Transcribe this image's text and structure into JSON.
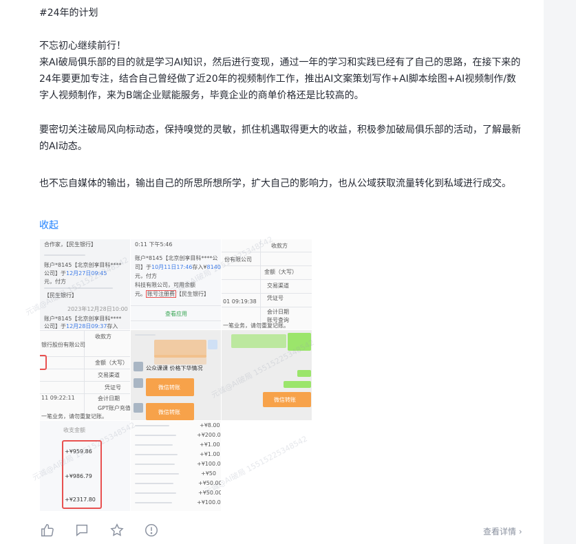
{
  "post": {
    "hashtag": "#24年的计划",
    "paragraph1": "不忘初心继续前行！\n来AI破局俱乐部的目的就是学习AI知识，然后进行变现，通过一年的学习和实践已经有了自己的思路，在接下来的24年要更加专注，结合自己曾经做了近20年的视频制作工作，推出AI文案策划写作+AI脚本绘图+AI视频制作/数字人视频制作，来为B端企业赋能服务，毕竟企业的商单价格还是比较高的。",
    "paragraph2": "要密切关注破局风向标动态，保持嗅觉的灵敏，抓住机遇取得更大的收益，积极参加破局俱乐部的活动，了解最新的AI动态。",
    "paragraph3": "也不忘自媒体的输出，输出自己的所思所想所学，扩大自己的影响力，也从公域获取流量转化到私域进行成交。",
    "collapse_label": "收起"
  },
  "images": {
    "img1": {
      "top_text": "合作家，【民生银行】",
      "acct_line1": "账户*8145【北京创享目科****",
      "acct_line2": "公司】于",
      "date1": "12月27日09:45",
      "acct_line3": "元，付方",
      "bank": "【民生银行】",
      "time_label": "2023年12月28日10:00",
      "acct2_line1": "账户*8145【北京创享目科****",
      "acct2_line2": "公司】于",
      "date2": "12月28日09:37",
      "suffix": "存入"
    },
    "img2": {
      "status": "0:11 下午5:46",
      "account_line": "账户*8145【北京创享目科****公",
      "line2_prefix": "司】于",
      "date": "10月11日17:46",
      "deposit_label": "存入¥",
      "amount": "8140.00",
      "line3": "元，付方",
      "line4": "科技有限公司，可用余额",
      "line5_prefix": "元。",
      "highlight": "账号注册费",
      "bank": "【民生银行】",
      "view_app": "查看应用"
    },
    "img3": {
      "col_header": "收款方",
      "company": "份有限公司",
      "labels": [
        "金额（大写）",
        "交易渠道",
        "凭证号",
        "会计日期",
        "账号查询"
      ],
      "time": "01 09:19:38",
      "footer": "一笔业务，请勿重复记账。"
    },
    "img4": {
      "col_header": "收款方",
      "company": "银行股份有限公司",
      "labels": [
        "金额（大写）",
        "交易渠道",
        "凭证号",
        "会计日期",
        "GPT账户充值"
      ],
      "time": "11 09:22:11",
      "footer": "一笔业务，请勿重复记账。"
    },
    "img5": {
      "chat_label": "公众课课 价格下华情况",
      "card_label": "微信转账"
    },
    "img6": {
      "card_label": "微信转账"
    },
    "img7": {
      "header": "收支金额",
      "amounts": [
        "+¥959.86",
        "+¥986.79",
        "+¥2317.80"
      ]
    },
    "img8": {
      "amounts": [
        "+¥8.00",
        "+¥200.00",
        "+¥1.00",
        "+¥1.00",
        "+¥100.00",
        "+¥50",
        "+¥50.00",
        "+¥50.00",
        "+¥100.00"
      ]
    }
  },
  "footer": {
    "more_label": "查看详情"
  },
  "watermark": "元诚@AI破局 15515225348542",
  "colors": {
    "link": "#1e80ff",
    "text": "#252933",
    "highlight_red": "#e8504f",
    "wechat_orange": "#f7a24a",
    "wechat_green": "#9be56b"
  }
}
